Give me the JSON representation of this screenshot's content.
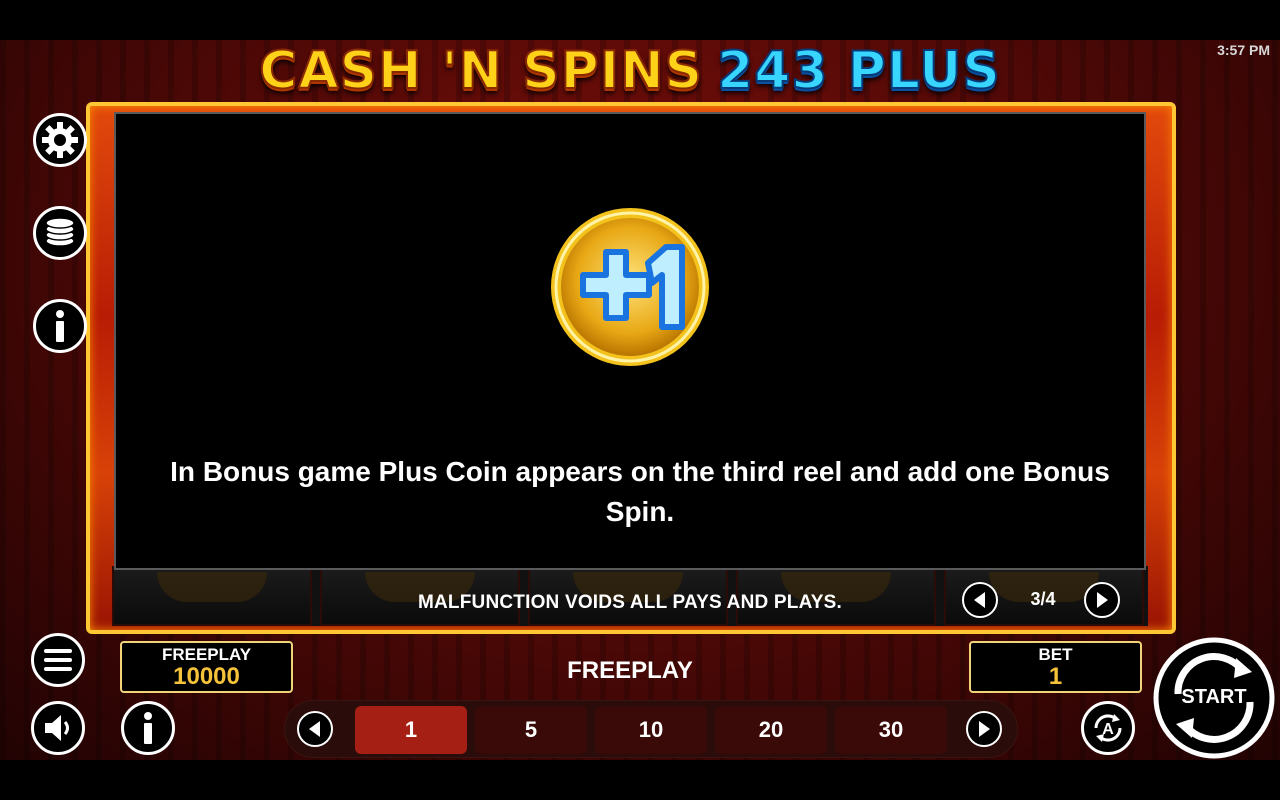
{
  "status_bar": {
    "time": "3:57 PM"
  },
  "game": {
    "title_part1": "CASH 'N SPINS",
    "title_part2": "243 PLUS"
  },
  "info_page": {
    "symbol_icon": "plus-one-coin-icon",
    "description": "In Bonus game Plus Coin appears on the third reel and add one Bonus Spin.",
    "disclaimer": "MALFUNCTION VOIDS ALL PAYS AND PLAYS.",
    "page_indicator": "3/4"
  },
  "side_menu": {
    "icons": [
      "gear-icon",
      "coin-stack-icon",
      "info-icon"
    ]
  },
  "bottom_controls": {
    "credit": {
      "label": "FREEPLAY",
      "value": "10000"
    },
    "mode_label": "FREEPLAY",
    "bet": {
      "label": "BET",
      "value": "1"
    },
    "bet_options": [
      "1",
      "5",
      "10",
      "20",
      "30"
    ],
    "selected_bet": "1",
    "start_label": "START",
    "icons": [
      "hamburger-menu-icon",
      "speaker-icon",
      "info-icon",
      "autoplay-icon",
      "start-spin-icon"
    ]
  },
  "colors": {
    "accent_gold": "#f5c23a",
    "title_yellow": "#ffd21a",
    "title_blue": "#38d6ff",
    "selected_bet_bg": "#a61f14",
    "frame_border": "#ffc733"
  }
}
